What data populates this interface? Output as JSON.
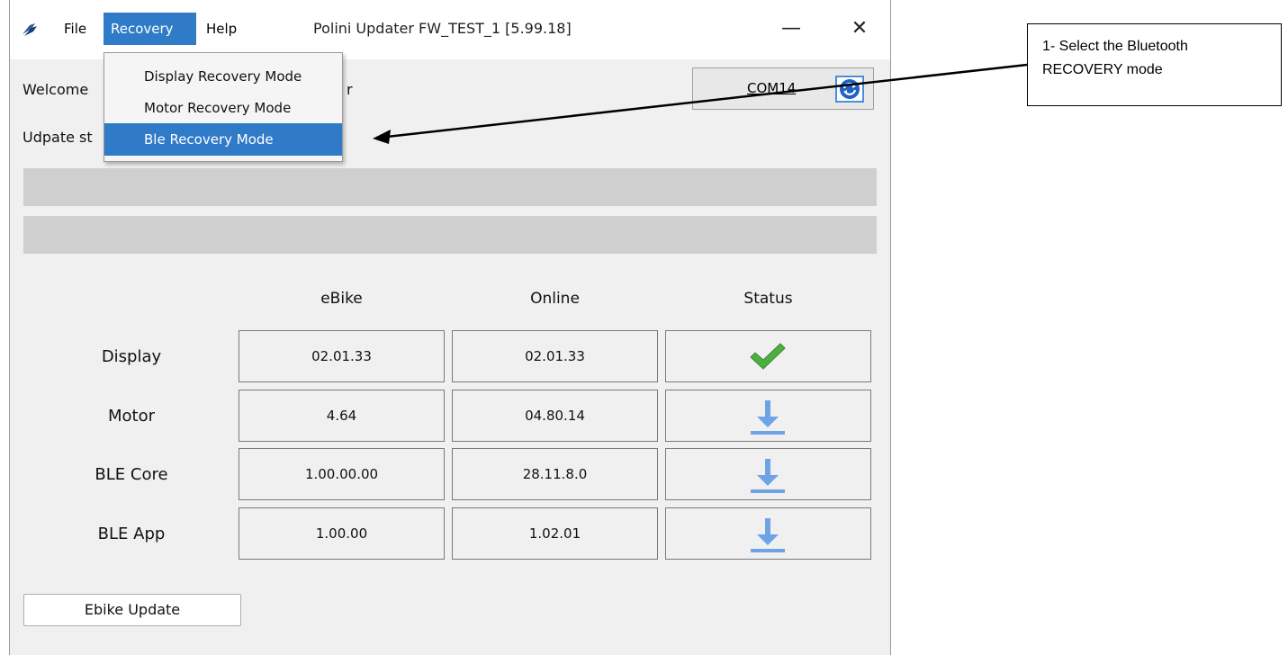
{
  "menubar": {
    "file": "File",
    "recovery": "Recovery",
    "help": "Help"
  },
  "window": {
    "title": "Polini Updater FW_TEST_1 [5.99.18]",
    "minimize_glyph": "—",
    "close_glyph": "✕"
  },
  "recovery_menu": {
    "items": [
      "Display Recovery Mode",
      "Motor Recovery Mode",
      "Ble Recovery Mode"
    ],
    "selected": "Ble Recovery Mode"
  },
  "welcome": {
    "left_text": "Welcome",
    "right_fragment": "r"
  },
  "update_status": {
    "label": "Udpate st"
  },
  "port": {
    "value": "COM14",
    "refresh_icon": "refresh-icon"
  },
  "table": {
    "headers": [
      "eBike",
      "Online",
      "Status"
    ],
    "rows": [
      {
        "label": "Display",
        "ebike": "02.01.33",
        "online": "02.01.33",
        "status": "check-icon"
      },
      {
        "label": "Motor",
        "ebike": "4.64",
        "online": "04.80.14",
        "status": "download-icon"
      },
      {
        "label": "BLE Core",
        "ebike": "1.00.00.00",
        "online": "28.11.8.0",
        "status": "download-icon"
      },
      {
        "label": "BLE App",
        "ebike": "1.00.00",
        "online": "1.02.01",
        "status": "download-icon"
      }
    ]
  },
  "actions": {
    "ebike_update": "Ebike Update"
  },
  "annotation": {
    "line1": "1- Select the Bluetooth",
    "line2": "RECOVERY mode"
  },
  "colors": {
    "menu_highlight": "#2f7bc8",
    "check": "#4caf3f",
    "download": "#6fa3e8"
  }
}
